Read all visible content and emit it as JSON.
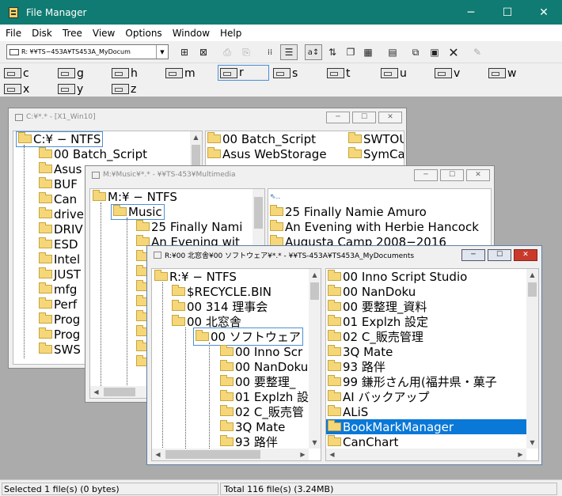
{
  "app": {
    "title": "File Manager"
  },
  "window_controls": {
    "minimize": "─",
    "maximize": "☐",
    "close": "✕"
  },
  "menu": [
    "File",
    "Disk",
    "Tree",
    "View",
    "Options",
    "Window",
    "Help"
  ],
  "toolbar": {
    "drive_combo": "R: ¥¥TS−453A¥TS453A_MyDocum",
    "buttons": [
      {
        "icon": "connect-drive-icon",
        "glyph": "⊞"
      },
      {
        "icon": "disconnect-drive-icon",
        "glyph": "⊠"
      },
      {
        "icon": "share-icon",
        "glyph": "⎙"
      },
      {
        "icon": "stop-share-icon",
        "glyph": "⎘"
      },
      {
        "icon": "large-icons-view-icon",
        "glyph": "⁞⁞"
      },
      {
        "icon": "list-view-icon",
        "glyph": "☰"
      },
      {
        "icon": "sort-by-name-icon",
        "glyph": "a↕"
      },
      {
        "icon": "sort-by-type-icon",
        "glyph": "⇅"
      },
      {
        "icon": "cascade-icon",
        "glyph": "❐"
      },
      {
        "icon": "tile-icon",
        "glyph": "▦"
      },
      {
        "icon": "new-window-icon",
        "glyph": "▤"
      },
      {
        "icon": "copy-icon",
        "glyph": "⧉"
      },
      {
        "icon": "paste-icon",
        "glyph": "▣"
      },
      {
        "icon": "delete-icon",
        "glyph": "✕"
      },
      {
        "icon": "properties-icon",
        "glyph": "✎"
      }
    ]
  },
  "drives": [
    "c",
    "g",
    "h",
    "m",
    "r",
    "s",
    "t",
    "u",
    "v",
    "w",
    "x",
    "y",
    "z"
  ],
  "windows": {
    "c": {
      "title": "C:¥*.* - [X1_Win10]",
      "tree": [
        "C:¥ − NTFS",
        "00 Batch_Script",
        "Asus",
        "BUF",
        "Can",
        "drive",
        "DRIV",
        "ESD",
        "Intel",
        "JUST",
        "mfg",
        "Perf",
        "Prog",
        "Prog",
        "SWS"
      ],
      "files": [
        "00 Batch_Script",
        "Asus WebStorage",
        "SWTOU",
        "SymCa"
      ]
    },
    "m": {
      "title": "M:¥Music¥*.* - ¥¥TS-453¥Multimedia",
      "tree": [
        "M:¥ − NTFS",
        "Music",
        "25 Finally Nami",
        "An Evening wit"
      ],
      "files": [
        "25 Finally Namie Amuro",
        "An Evening with Herbie Hancock",
        "Augusta Camp 2008−2016"
      ]
    },
    "r": {
      "title": "R:¥00 北窓舎¥00 ソフトウェア¥*.* - ¥¥TS-453A¥TS453A_MyDocuments",
      "tree": [
        "R:¥ − NTFS",
        "$RECYCLE.BIN",
        "00 314 理事会",
        "00 北窓舎",
        "00 ソフトウェア",
        "00 Inno Scr",
        "00 NanDoku",
        "00 要整理_",
        "01 Explzh 設",
        "02 C_販売管",
        "3Q Mate",
        "93 路伴"
      ],
      "files": [
        "00 Inno Script Studio",
        "00 NanDoku",
        "00 要整理_資料",
        "01 Explzh 設定",
        "02 C_販売管理",
        "3Q Mate",
        "93 路伴",
        "99 鎌形さん用(福井県・菓子",
        "AI バックアップ",
        "ALiS",
        "BookMarkManager",
        "CanChart"
      ],
      "selected_file": "BookMarkManager"
    }
  },
  "status": {
    "selected": "Selected 1 file(s) (0 bytes)",
    "total": "Total 116 file(s) (3.24MB)"
  }
}
